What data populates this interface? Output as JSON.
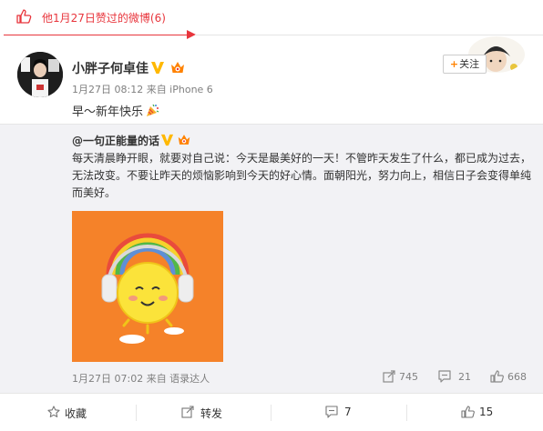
{
  "header": {
    "title": "他1月27日赞过的微博(6)",
    "accent_color": "#e8353c"
  },
  "post": {
    "author": "小胖子何卓佳",
    "meta": "1月27日 08:12 来自 iPhone 6",
    "text": "早～新年快乐",
    "follow_label": "关注"
  },
  "repost": {
    "author": "@一句正能量的话",
    "body": "每天清晨睁开眼，就要对自己说：今天是最美好的一天！不管昨天发生了什么，都已成为过去，无法改变。不要让昨天的烦恼影响到今天的好心情。面朝阳光，努力向上，相信日子会变得单纯而美好。",
    "time": "1月27日 07:02 来自 语录达人",
    "repost_count": "745",
    "comment_count": "21",
    "like_count": "668"
  },
  "actions": {
    "favorite_label": "收藏",
    "forward_label": "转发",
    "comment_count": "7",
    "like_count": "15"
  }
}
